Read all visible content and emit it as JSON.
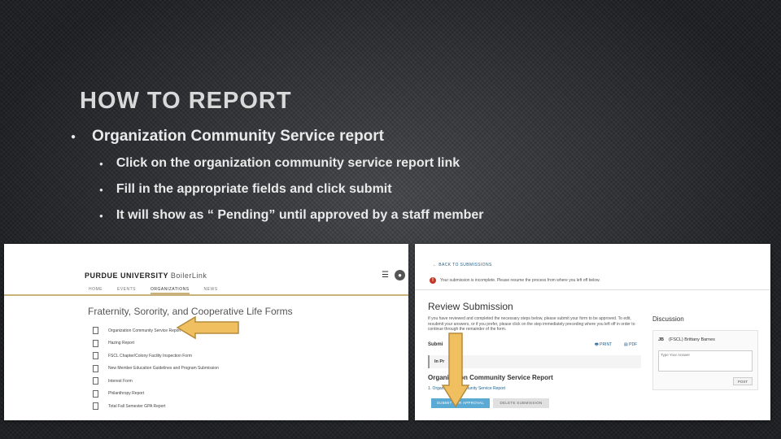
{
  "slide": {
    "title": "HOW TO REPORT",
    "bullets": [
      "Organization   Community Service report",
      "Click on the organization community service report link",
      "Fill in the appropriate fields and click submit",
      "It will show as “ Pending” until approved by a staff member"
    ]
  },
  "left_screenshot": {
    "brand": "PURDUE UNIVERSITY",
    "brand_sub": "BoilerLink",
    "nav": [
      "HOME",
      "EVENTS",
      "ORGANIZATIONS",
      "NEWS"
    ],
    "active_nav": "ORGANIZATIONS",
    "heading": "Fraternity, Sorority, and Cooperative Life Forms",
    "forms": [
      "Organization Community Service Report",
      "Hazing Report",
      "FSCL Chapter/Colony Facility Inspection Form",
      "New Member Education Guidelines and Program Submission",
      "Interest Form",
      "Philanthropy Report",
      "Total Fall Semester GPA Report"
    ]
  },
  "right_screenshot": {
    "back_link": "BACK TO SUBMISSIONS",
    "alert": "Your submission is incomplete. Please resume the process from where you left off below.",
    "title": "Review Submission",
    "paragraph": "If you have reviewed and completed the necessary steps below, please submit your form to be approved. To edit, resubmit your answers, or if you prefer, please click on the step immediately preceding where you left off in order to continue through the remainder of the form.",
    "submit_label": "Submi",
    "print": "PRINT",
    "pdf": "PDF",
    "in_progress": "In Pr",
    "section_title": "Organization Community Service Report",
    "section_item": "1. Organization Community Service Report",
    "approve_btn": "SUBMIT FOR APPROVAL",
    "delete_btn": "DELETE SUBMISSION",
    "discussion": {
      "title": "Discussion",
      "user_initials": "JB",
      "user_name": "(FSCL) Brittany Barnes",
      "placeholder": "Type Your Answer",
      "post": "POST"
    }
  },
  "colors": {
    "arrow_fill": "#f0c060",
    "arrow_stroke": "#b58a3a",
    "approve_button": "#5aaad4",
    "gold_rule": "#c8b27a"
  }
}
